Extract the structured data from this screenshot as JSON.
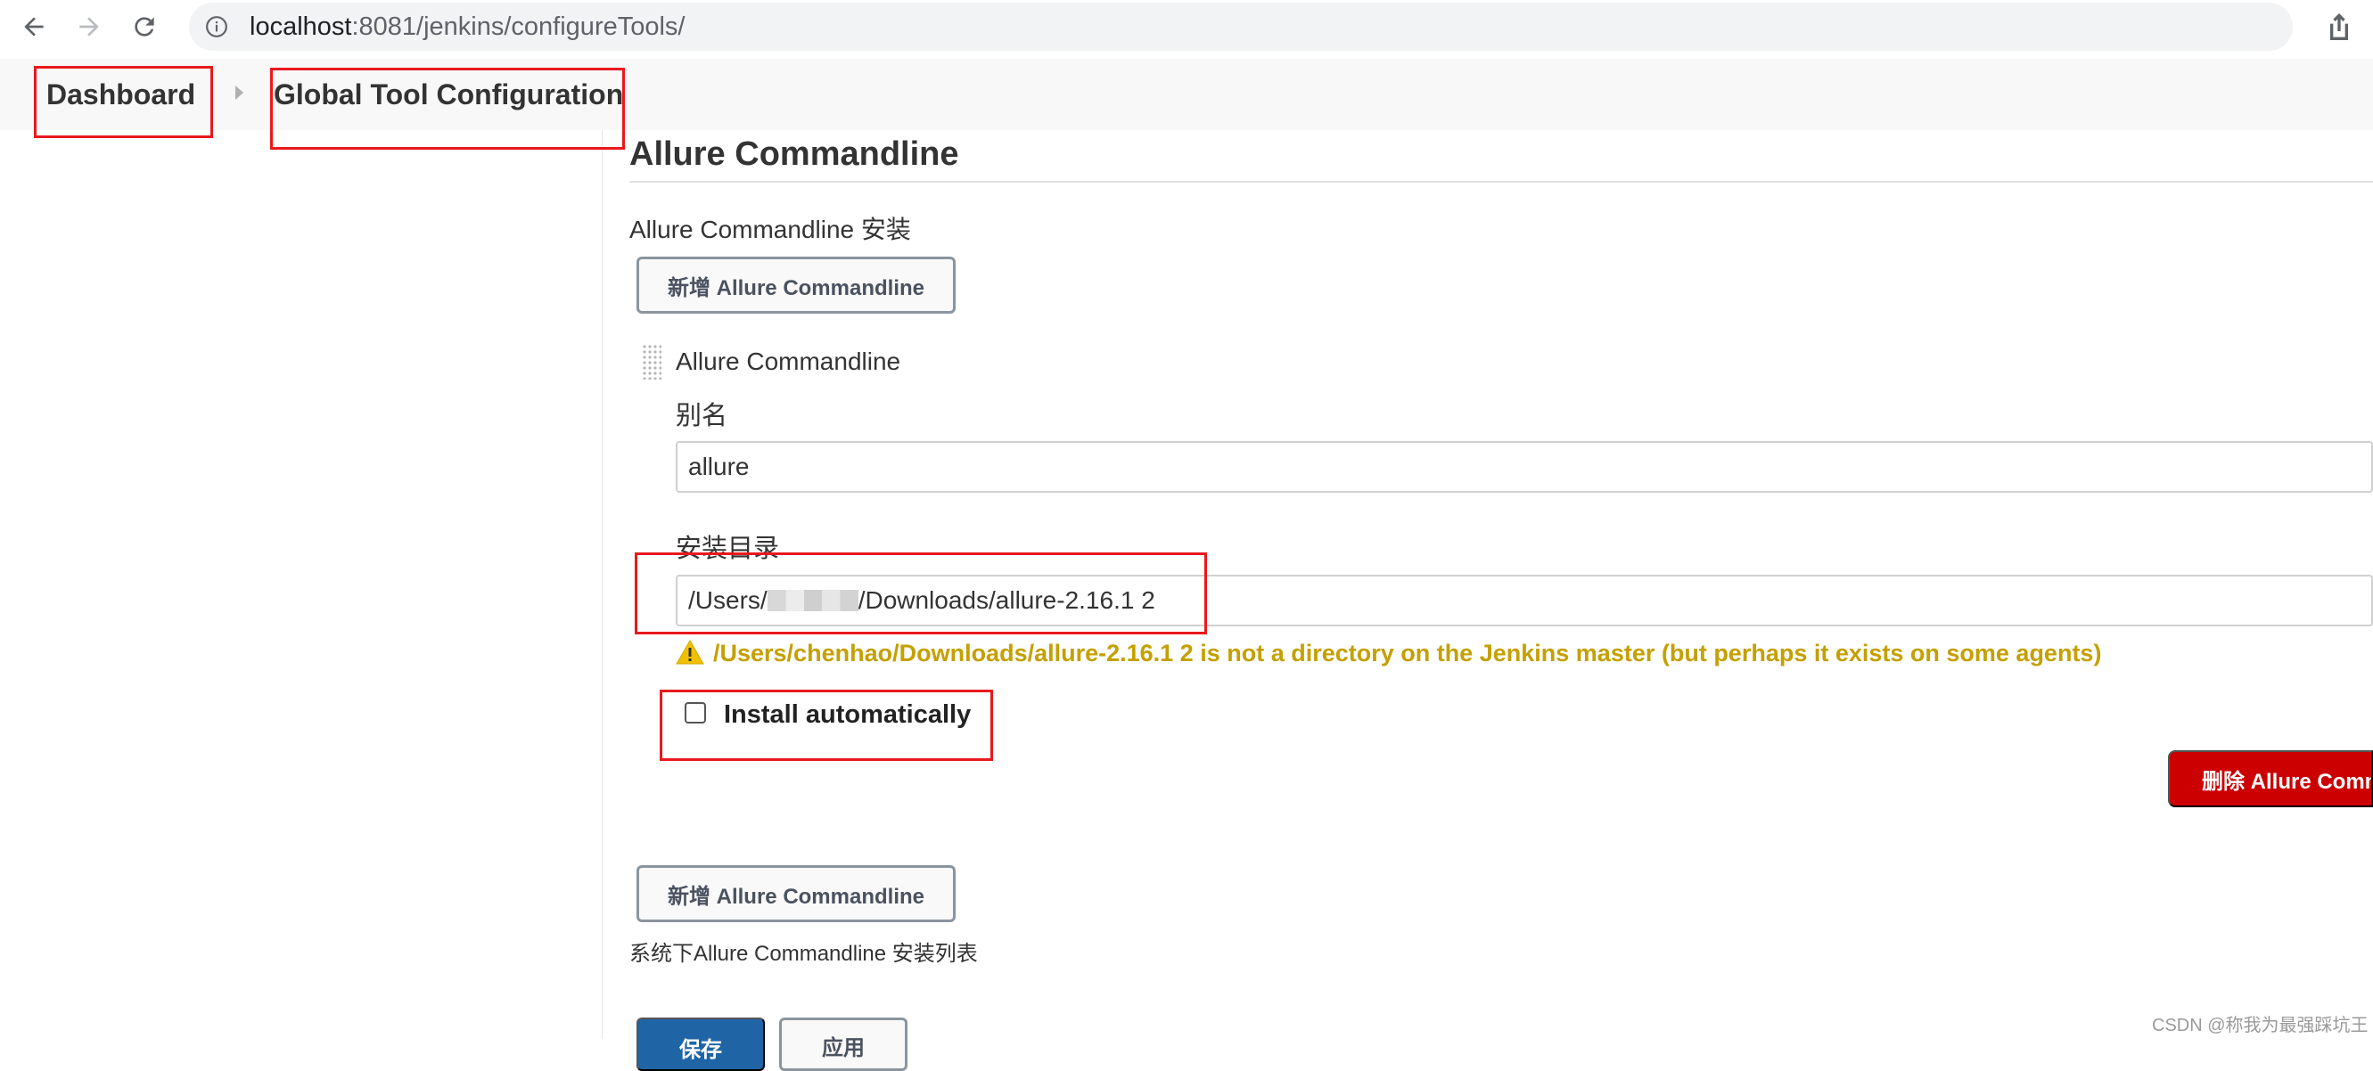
{
  "browser": {
    "url_host": "localhost",
    "url_path": ":8081/jenkins/configureTools/"
  },
  "breadcrumb": {
    "dashboard": "Dashboard",
    "global_tool_configuration": "Global Tool Configuration"
  },
  "section": {
    "title": "Allure Commandline",
    "installations_label": "Allure Commandline 安装",
    "add_button_label": "新增 Allure Commandline",
    "item": {
      "header": "Allure Commandline",
      "alias_label": "别名",
      "alias_value": "allure",
      "install_dir_label": "安装目录",
      "install_dir_prefix": "/Users/",
      "install_dir_suffix": "/Downloads/allure-2.16.1 2",
      "warning": "/Users/chenhao/Downloads/allure-2.16.1 2 is not a directory on the Jenkins master (but perhaps it exists on some agents)",
      "install_automatically_label": "Install automatically",
      "install_automatically_checked": false,
      "delete_button_label": "删除 Allure Commandline"
    },
    "add_button_bottom_label": "新增 Allure Commandline",
    "list_description": "系统下Allure Commandline 安装列表"
  },
  "footer": {
    "save_label": "保存",
    "apply_label": "应用"
  },
  "watermark": "CSDN @称我为最强踩坑王",
  "colors": {
    "warning": "#c4a000",
    "delete": "#cc0000",
    "primary": "#1f65a6",
    "annotation": "#e8191d"
  }
}
